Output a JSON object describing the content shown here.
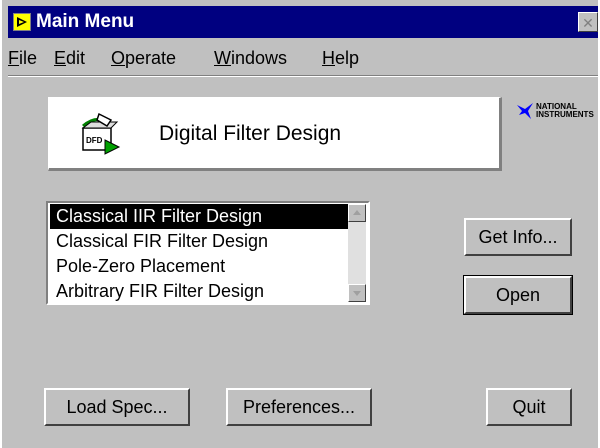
{
  "window": {
    "title": "Main Menu",
    "close_label": "✕"
  },
  "menu": [
    {
      "key": "F",
      "rest": "ile"
    },
    {
      "key": "E",
      "rest": "dit"
    },
    {
      "key": "O",
      "rest": "perate"
    },
    {
      "key": "W",
      "rest": "indows"
    },
    {
      "key": "H",
      "rest": "elp"
    }
  ],
  "banner": {
    "title": "Digital Filter Design",
    "icon_text": "DFD"
  },
  "logo": {
    "line1": "NATIONAL",
    "line2": "INSTRUMENTS"
  },
  "list": {
    "items": [
      "Classical IIR Filter Design",
      "Classical FIR Filter Design",
      "Pole-Zero Placement",
      "Arbitrary FIR Filter Design"
    ],
    "selected_index": 0
  },
  "buttons": {
    "get_info": "Get Info...",
    "open": "Open",
    "load_spec": "Load Spec...",
    "preferences": "Preferences...",
    "quit": "Quit"
  }
}
